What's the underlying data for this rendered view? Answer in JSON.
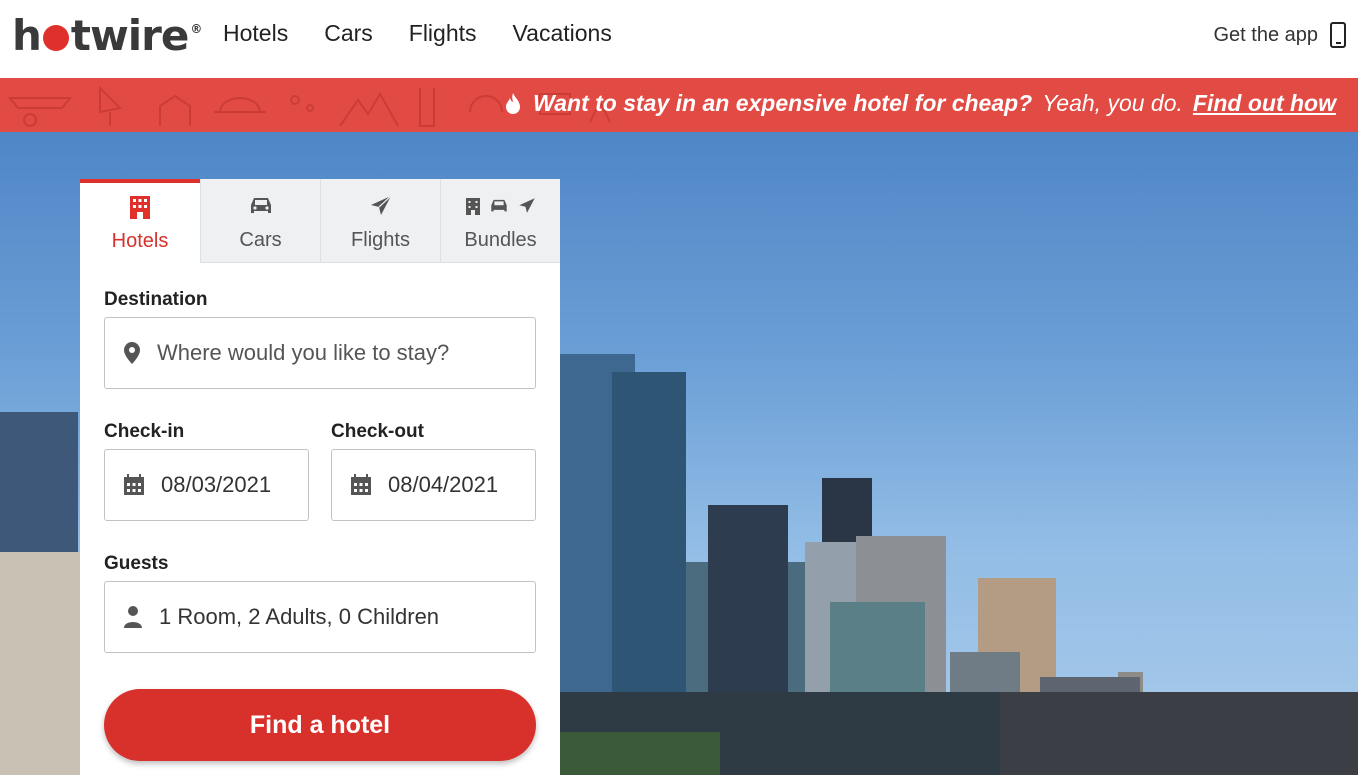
{
  "header": {
    "logo": {
      "prefix": "h",
      "suffix": "twire",
      "reg": "®"
    },
    "nav": [
      "Hotels",
      "Cars",
      "Flights",
      "Vacations"
    ],
    "get_app": "Get the app"
  },
  "promo": {
    "headline": "Want to stay in an expensive hotel for cheap?",
    "tagline": "Yeah, you do.",
    "link": "Find out how"
  },
  "search": {
    "tabs": [
      {
        "label": "Hotels",
        "icon": "hotel-icon",
        "active": true
      },
      {
        "label": "Cars",
        "icon": "car-icon",
        "active": false
      },
      {
        "label": "Flights",
        "icon": "plane-icon",
        "active": false
      },
      {
        "label": "Bundles",
        "icon": "bundle-icons",
        "active": false
      }
    ],
    "destination_label": "Destination",
    "destination_placeholder": "Where would you like to stay?",
    "checkin_label": "Check-in",
    "checkin_value": "08/03/2021",
    "checkout_label": "Check-out",
    "checkout_value": "08/04/2021",
    "guests_label": "Guests",
    "guests_value": "1 Room, 2 Adults, 0 Children",
    "submit": "Find a hotel"
  },
  "colors": {
    "brand_red": "#e0302b",
    "promo_bg": "#e24a44",
    "button": "#d8312c"
  }
}
